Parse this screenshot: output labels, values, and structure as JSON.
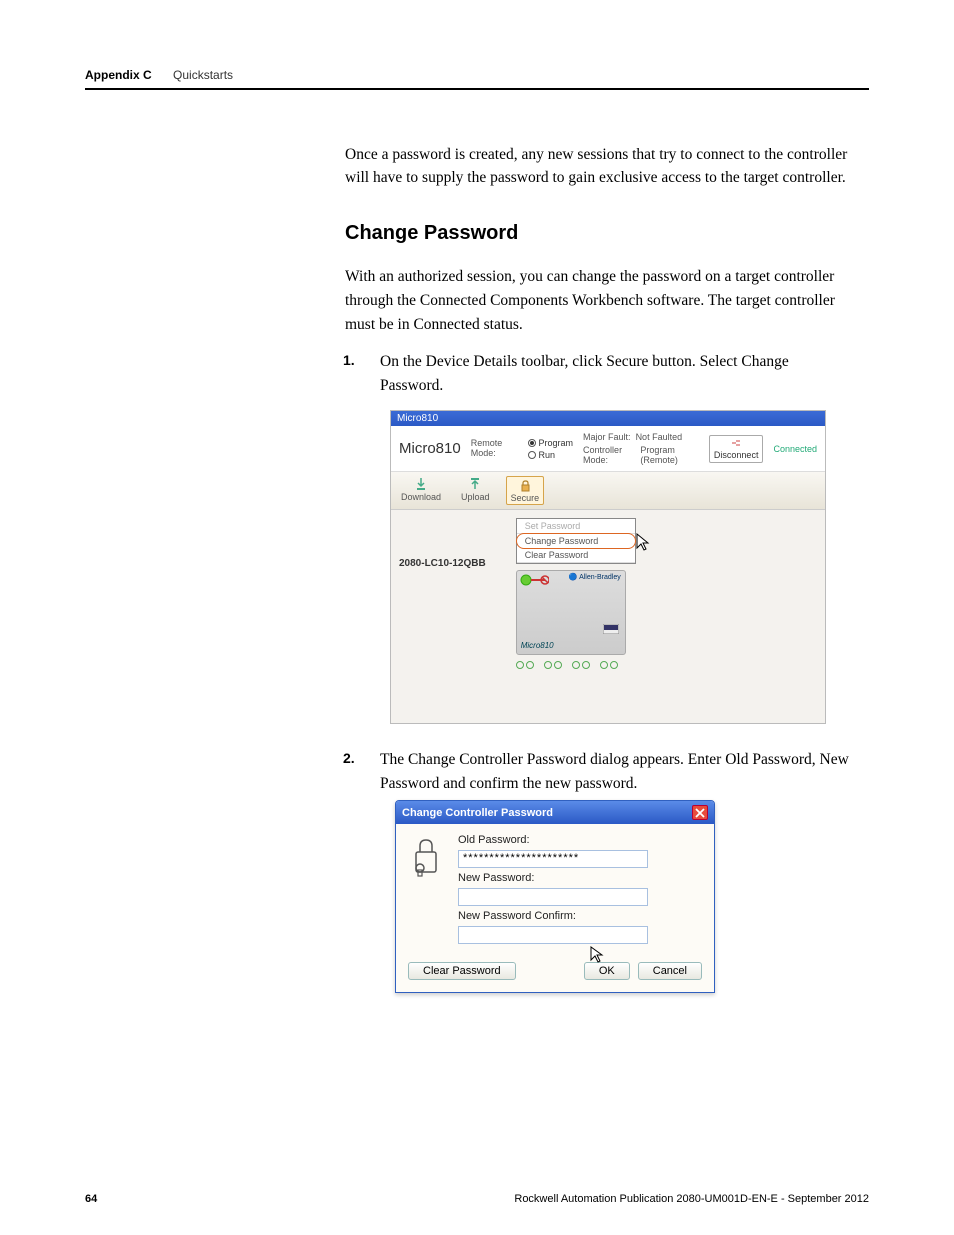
{
  "header": {
    "appendix": "Appendix C",
    "section": "Quickstarts"
  },
  "intro": "Once a password is created, any new sessions that try to connect to the controller will have to supply the password to gain exclusive access to the target controller.",
  "heading": "Change Password",
  "desc": "With an authorized session, you can change the password on a target controller through the Connected Components Workbench software. The target controller must be in Connected status.",
  "step1": {
    "num": "1.",
    "text": "On the Device Details toolbar, click Secure button. Select Change Password."
  },
  "step2": {
    "num": "2.",
    "text": "The Change Controller Password dialog appears. Enter Old Password, New Password and confirm the new password."
  },
  "shot1": {
    "tab": "Micro810",
    "title": "Micro810",
    "modeLabel": "Remote Mode:",
    "radio_program": "Program",
    "radio_run": "Run",
    "majorFaultLabel": "Major Fault:",
    "majorFaultVal": "Not Faulted",
    "ctrlModeLabel": "Controller Mode:",
    "ctrlModeVal": "Program (Remote)",
    "disconnect": "Disconnect",
    "connected": "Connected",
    "download": "Download",
    "upload": "Upload",
    "secure": "Secure",
    "catalog": "2080-LC10-12QBB",
    "menu_set": "Set Password",
    "menu_change": "Change Password",
    "menu_clear": "Clear Password",
    "devLabel": "Micro810",
    "devBrand": "Allen-Bradley"
  },
  "shot2": {
    "title": "Change Controller Password",
    "label_old": "Old Password:",
    "val_old": "**********************",
    "label_new": "New Password:",
    "label_conf": "New Password Confirm:",
    "btn_clear": "Clear Password",
    "btn_ok": "OK",
    "btn_cancel": "Cancel"
  },
  "footer": {
    "page": "64",
    "pub": "Rockwell Automation Publication 2080-UM001D-EN-E - September 2012"
  }
}
